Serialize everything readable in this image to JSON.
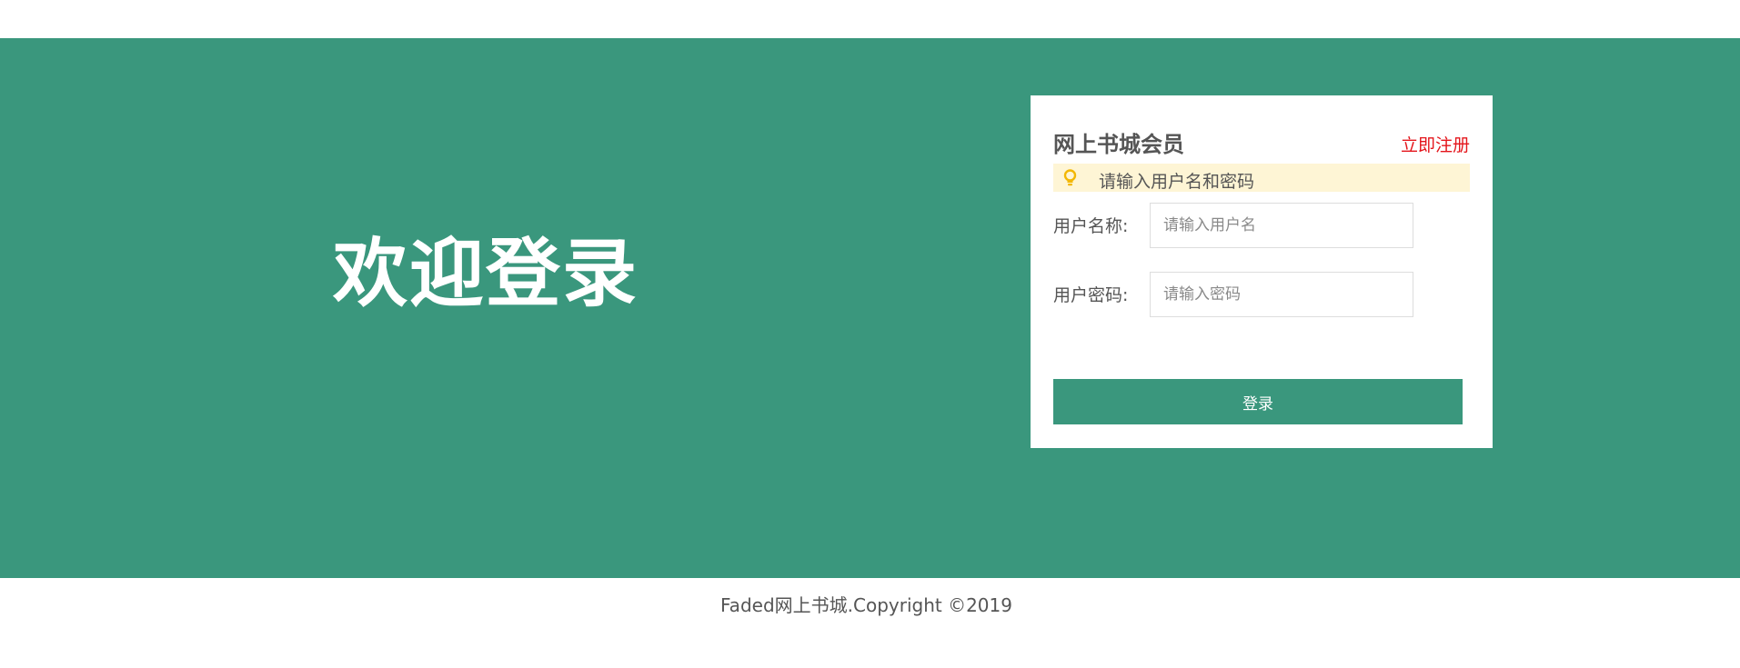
{
  "hero": {
    "welcome_text": "欢迎登录",
    "background_color": "#3a977d"
  },
  "login": {
    "title": "网上书城会员",
    "register_link": "立即注册",
    "hint_icon": "lightbulb-icon",
    "hint_text": "请输入用户名和密码",
    "username_label": "用户名称:",
    "username_placeholder": "请输入用户名",
    "username_value": "",
    "password_label": "用户密码:",
    "password_placeholder": "请输入密码",
    "password_value": "",
    "submit_label": "登录",
    "accent_color": "#3a977d",
    "link_color": "#e4151b",
    "hint_background": "#fef5d5"
  },
  "footer": {
    "copyright": "Faded网上书城.Copyright ©2019"
  }
}
